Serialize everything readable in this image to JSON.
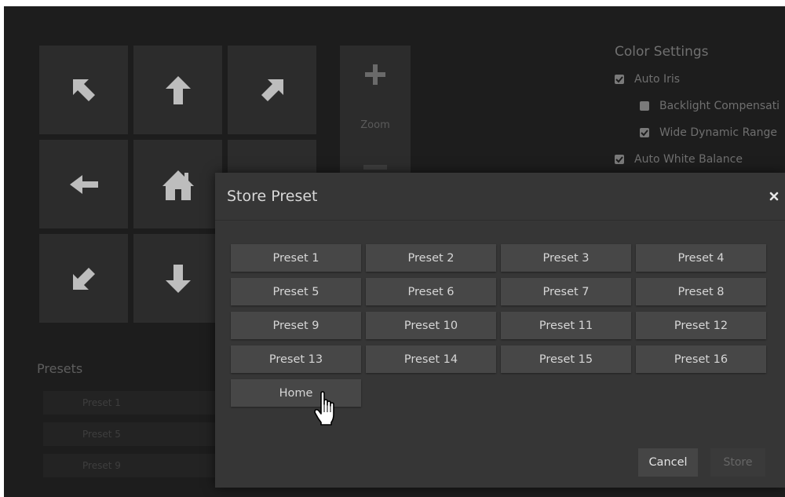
{
  "ptz": {
    "zoom_label": "Zoom"
  },
  "color_settings": {
    "title": "Color Settings",
    "items": [
      {
        "label": "Auto Iris",
        "checked": true,
        "indent": false
      },
      {
        "label": "Backlight Compensati",
        "checked": false,
        "indent": true
      },
      {
        "label": "Wide Dynamic Range",
        "checked": true,
        "indent": true
      },
      {
        "label": "Auto White Balance",
        "checked": true,
        "indent": false
      }
    ]
  },
  "presets_panel": {
    "title": "Presets",
    "items": [
      "Preset 1",
      "Preset 5",
      "Preset 9"
    ]
  },
  "modal": {
    "title": "Store Preset",
    "presets": [
      "Preset 1",
      "Preset 2",
      "Preset 3",
      "Preset 4",
      "Preset 5",
      "Preset 6",
      "Preset 7",
      "Preset 8",
      "Preset 9",
      "Preset 10",
      "Preset 11",
      "Preset 12",
      "Preset 13",
      "Preset 14",
      "Preset 15",
      "Preset 16",
      "Home"
    ],
    "cancel_label": "Cancel",
    "store_label": "Store"
  },
  "colors": {
    "background": "#1d1d1d",
    "modal_bg": "#363636",
    "button_bg": "#474747",
    "text": "#d6d6d6"
  },
  "icons": {
    "pad": [
      "arrow-up-left-icon",
      "arrow-up-icon",
      "arrow-up-right-icon",
      "arrow-left-icon",
      "home-icon",
      "arrow-right-icon",
      "arrow-down-left-icon",
      "arrow-down-icon",
      "arrow-down-right-icon"
    ],
    "close": "close-icon",
    "cursor": "hand-pointer-icon"
  }
}
